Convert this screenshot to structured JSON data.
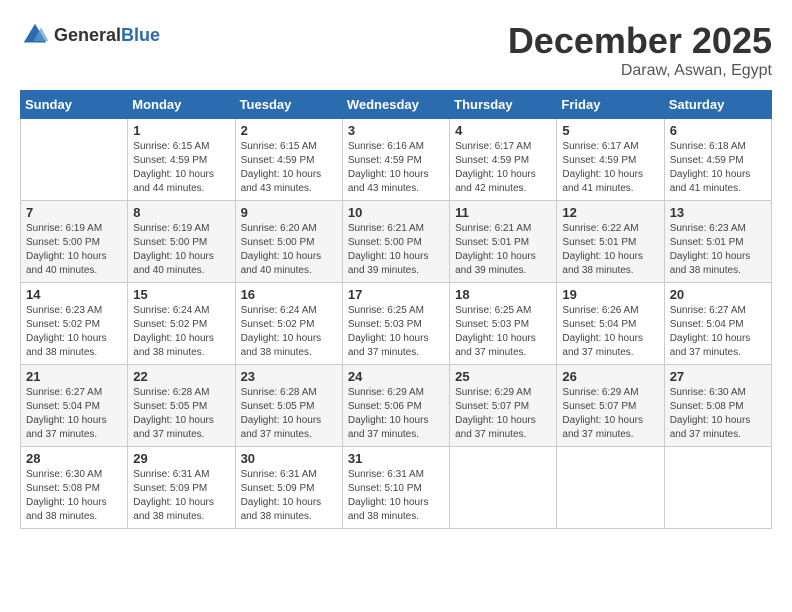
{
  "logo": {
    "general": "General",
    "blue": "Blue"
  },
  "title": "December 2025",
  "location": "Daraw, Aswan, Egypt",
  "weekdays": [
    "Sunday",
    "Monday",
    "Tuesday",
    "Wednesday",
    "Thursday",
    "Friday",
    "Saturday"
  ],
  "rows": [
    [
      {
        "day": "",
        "info": ""
      },
      {
        "day": "1",
        "info": "Sunrise: 6:15 AM\nSunset: 4:59 PM\nDaylight: 10 hours\nand 44 minutes."
      },
      {
        "day": "2",
        "info": "Sunrise: 6:15 AM\nSunset: 4:59 PM\nDaylight: 10 hours\nand 43 minutes."
      },
      {
        "day": "3",
        "info": "Sunrise: 6:16 AM\nSunset: 4:59 PM\nDaylight: 10 hours\nand 43 minutes."
      },
      {
        "day": "4",
        "info": "Sunrise: 6:17 AM\nSunset: 4:59 PM\nDaylight: 10 hours\nand 42 minutes."
      },
      {
        "day": "5",
        "info": "Sunrise: 6:17 AM\nSunset: 4:59 PM\nDaylight: 10 hours\nand 41 minutes."
      },
      {
        "day": "6",
        "info": "Sunrise: 6:18 AM\nSunset: 4:59 PM\nDaylight: 10 hours\nand 41 minutes."
      }
    ],
    [
      {
        "day": "7",
        "info": "Sunrise: 6:19 AM\nSunset: 5:00 PM\nDaylight: 10 hours\nand 40 minutes."
      },
      {
        "day": "8",
        "info": "Sunrise: 6:19 AM\nSunset: 5:00 PM\nDaylight: 10 hours\nand 40 minutes."
      },
      {
        "day": "9",
        "info": "Sunrise: 6:20 AM\nSunset: 5:00 PM\nDaylight: 10 hours\nand 40 minutes."
      },
      {
        "day": "10",
        "info": "Sunrise: 6:21 AM\nSunset: 5:00 PM\nDaylight: 10 hours\nand 39 minutes."
      },
      {
        "day": "11",
        "info": "Sunrise: 6:21 AM\nSunset: 5:01 PM\nDaylight: 10 hours\nand 39 minutes."
      },
      {
        "day": "12",
        "info": "Sunrise: 6:22 AM\nSunset: 5:01 PM\nDaylight: 10 hours\nand 38 minutes."
      },
      {
        "day": "13",
        "info": "Sunrise: 6:23 AM\nSunset: 5:01 PM\nDaylight: 10 hours\nand 38 minutes."
      }
    ],
    [
      {
        "day": "14",
        "info": "Sunrise: 6:23 AM\nSunset: 5:02 PM\nDaylight: 10 hours\nand 38 minutes."
      },
      {
        "day": "15",
        "info": "Sunrise: 6:24 AM\nSunset: 5:02 PM\nDaylight: 10 hours\nand 38 minutes."
      },
      {
        "day": "16",
        "info": "Sunrise: 6:24 AM\nSunset: 5:02 PM\nDaylight: 10 hours\nand 38 minutes."
      },
      {
        "day": "17",
        "info": "Sunrise: 6:25 AM\nSunset: 5:03 PM\nDaylight: 10 hours\nand 37 minutes."
      },
      {
        "day": "18",
        "info": "Sunrise: 6:25 AM\nSunset: 5:03 PM\nDaylight: 10 hours\nand 37 minutes."
      },
      {
        "day": "19",
        "info": "Sunrise: 6:26 AM\nSunset: 5:04 PM\nDaylight: 10 hours\nand 37 minutes."
      },
      {
        "day": "20",
        "info": "Sunrise: 6:27 AM\nSunset: 5:04 PM\nDaylight: 10 hours\nand 37 minutes."
      }
    ],
    [
      {
        "day": "21",
        "info": "Sunrise: 6:27 AM\nSunset: 5:04 PM\nDaylight: 10 hours\nand 37 minutes."
      },
      {
        "day": "22",
        "info": "Sunrise: 6:28 AM\nSunset: 5:05 PM\nDaylight: 10 hours\nand 37 minutes."
      },
      {
        "day": "23",
        "info": "Sunrise: 6:28 AM\nSunset: 5:05 PM\nDaylight: 10 hours\nand 37 minutes."
      },
      {
        "day": "24",
        "info": "Sunrise: 6:29 AM\nSunset: 5:06 PM\nDaylight: 10 hours\nand 37 minutes."
      },
      {
        "day": "25",
        "info": "Sunrise: 6:29 AM\nSunset: 5:07 PM\nDaylight: 10 hours\nand 37 minutes."
      },
      {
        "day": "26",
        "info": "Sunrise: 6:29 AM\nSunset: 5:07 PM\nDaylight: 10 hours\nand 37 minutes."
      },
      {
        "day": "27",
        "info": "Sunrise: 6:30 AM\nSunset: 5:08 PM\nDaylight: 10 hours\nand 37 minutes."
      }
    ],
    [
      {
        "day": "28",
        "info": "Sunrise: 6:30 AM\nSunset: 5:08 PM\nDaylight: 10 hours\nand 38 minutes."
      },
      {
        "day": "29",
        "info": "Sunrise: 6:31 AM\nSunset: 5:09 PM\nDaylight: 10 hours\nand 38 minutes."
      },
      {
        "day": "30",
        "info": "Sunrise: 6:31 AM\nSunset: 5:09 PM\nDaylight: 10 hours\nand 38 minutes."
      },
      {
        "day": "31",
        "info": "Sunrise: 6:31 AM\nSunset: 5:10 PM\nDaylight: 10 hours\nand 38 minutes."
      },
      {
        "day": "",
        "info": ""
      },
      {
        "day": "",
        "info": ""
      },
      {
        "day": "",
        "info": ""
      }
    ]
  ]
}
